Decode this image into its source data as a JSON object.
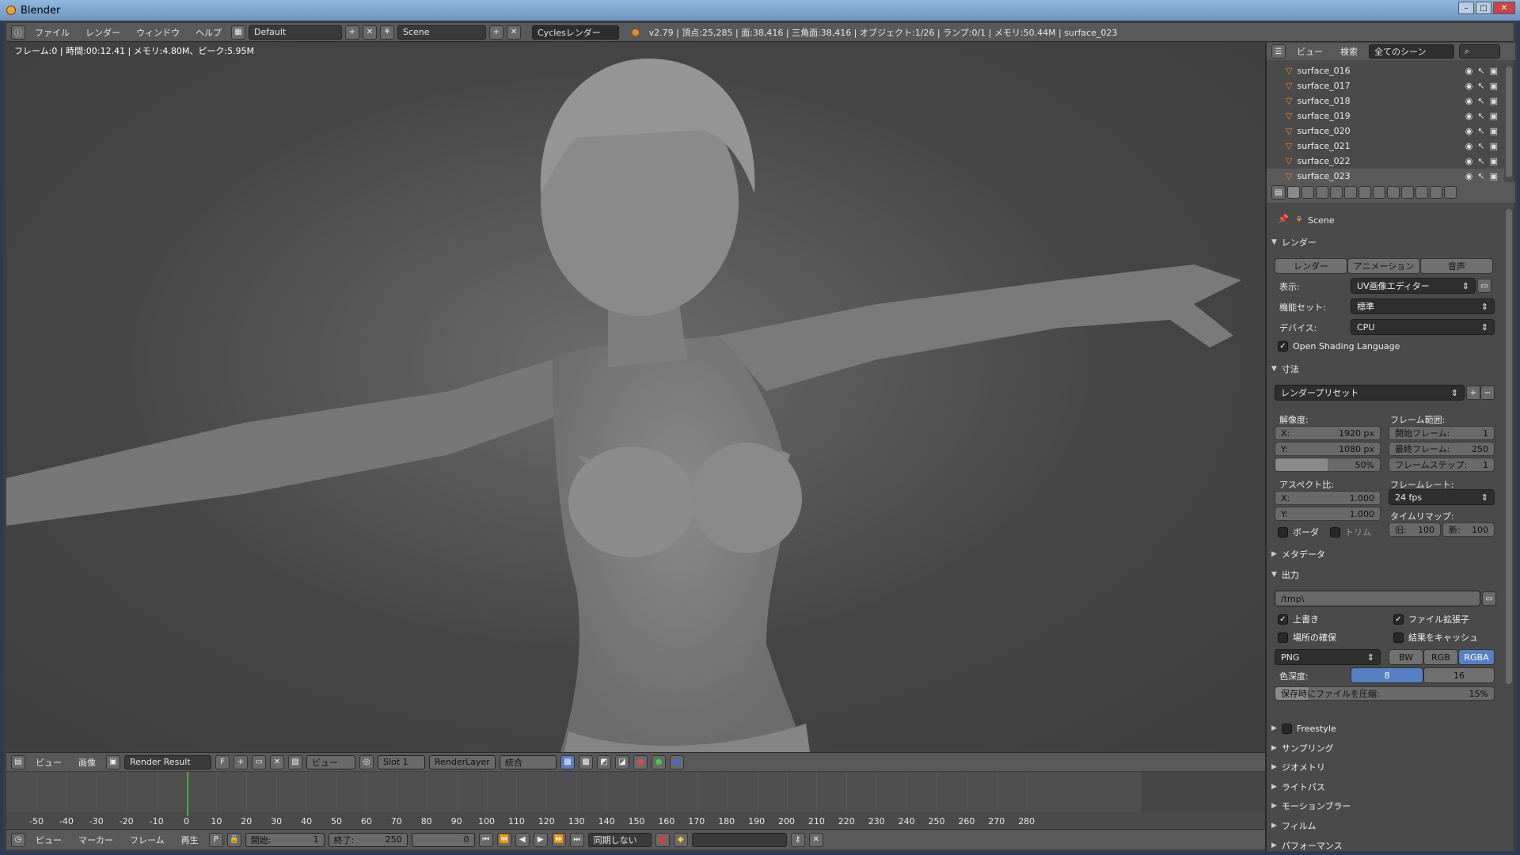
{
  "window": {
    "title": "Blender"
  },
  "topbar": {
    "menus": [
      "ファイル",
      "レンダー",
      "ウィンドウ",
      "ヘルプ"
    ],
    "layout": "Default",
    "scene": "Scene",
    "engine": "Cyclesレンダー",
    "stats": "v2.79 | 頂点:25,285 | 面:38,416 | 三角面:38,416 | オブジェクト:1/26 | ランプ:0/1 | メモリ:50.44M | surface_023"
  },
  "viewport": {
    "info": "フレーム:0 | 時間:00:12.41 | メモリ:4.80M、ピーク:5.95M"
  },
  "image_header": {
    "menus": [
      "ビュー",
      "画像"
    ],
    "image_name": "Render Result",
    "fake_user": "F",
    "view_mode": "ビュー",
    "slot": "Slot 1",
    "layer": "RenderLayer",
    "pass": "統合"
  },
  "timeline": {
    "ticks": [
      -50,
      -40,
      -30,
      -20,
      -10,
      0,
      10,
      20,
      30,
      40,
      50,
      60,
      70,
      80,
      90,
      100,
      110,
      120,
      130,
      140,
      150,
      160,
      170,
      180,
      190,
      200,
      210,
      220,
      230,
      240,
      250,
      260,
      270,
      280
    ],
    "current_frame": 0,
    "menus": [
      "ビュー",
      "マーカー",
      "フレーム",
      "再生"
    ],
    "start_label": "開始:",
    "start": "1",
    "end_label": "終了:",
    "end": "250",
    "frame": "0",
    "sync": "同期しない"
  },
  "outliner": {
    "menus": [
      "ビュー",
      "検索"
    ],
    "scope": "全てのシーン",
    "items": [
      "surface_016",
      "surface_017",
      "surface_018",
      "surface_019",
      "surface_020",
      "surface_021",
      "surface_022",
      "surface_023"
    ]
  },
  "properties": {
    "scene": "Scene",
    "render_panel": {
      "title": "レンダー",
      "buttons": [
        "レンダー",
        "アニメーション",
        "音声"
      ],
      "display_label": "表示:",
      "display_value": "UV画像エディター",
      "featureset_label": "機能セット:",
      "featureset_value": "標準",
      "device_label": "デバイス:",
      "device_value": "CPU",
      "osl": "Open Shading Language"
    },
    "dimensions_panel": {
      "title": "寸法",
      "preset": "レンダープリセット",
      "resolution_label": "解像度:",
      "res_x_label": "X:",
      "res_x": "1920 px",
      "res_y_label": "Y:",
      "res_y": "1080 px",
      "res_pct": "50%",
      "frame_range_label": "フレーム範囲:",
      "start_frame_label": "開始フレーム:",
      "start_frame": "1",
      "end_frame_label": "最終フレーム:",
      "end_frame": "250",
      "frame_step_label": "フレームステップ:",
      "frame_step": "1",
      "aspect_label": "アスペクト比:",
      "asp_x_label": "X:",
      "asp_x": "1.000",
      "asp_y_label": "Y:",
      "asp_y": "1.000",
      "framerate_label": "フレームレート:",
      "framerate": "24 fps",
      "timeremap_label": "タイムリマップ:",
      "old_label": "旧:",
      "old": "100",
      "new_label": "新:",
      "new": "100",
      "border": "ボーダ",
      "crop": "トリム"
    },
    "metadata_panel": {
      "title": "メタデータ"
    },
    "output_panel": {
      "title": "出力",
      "path": "/tmp\\",
      "overwrite": "上書き",
      "file_ext": "ファイル拡張子",
      "placeholders": "場所の確保",
      "cache_result": "結果をキャッシュ",
      "format": "PNG",
      "bw": "BW",
      "rgb": "RGB",
      "rgba": "RGBA",
      "color_depth_label": "色深度:",
      "depth_8": "8",
      "depth_16": "16",
      "compression_label": "保存時にファイルを圧縮:",
      "compression": "15%"
    },
    "collapsed_panels": [
      "Freestyle",
      "サンプリング",
      "ジオメトリ",
      "ライトパス",
      "モーションブラー",
      "フィルム",
      "パフォーマンス"
    ]
  }
}
